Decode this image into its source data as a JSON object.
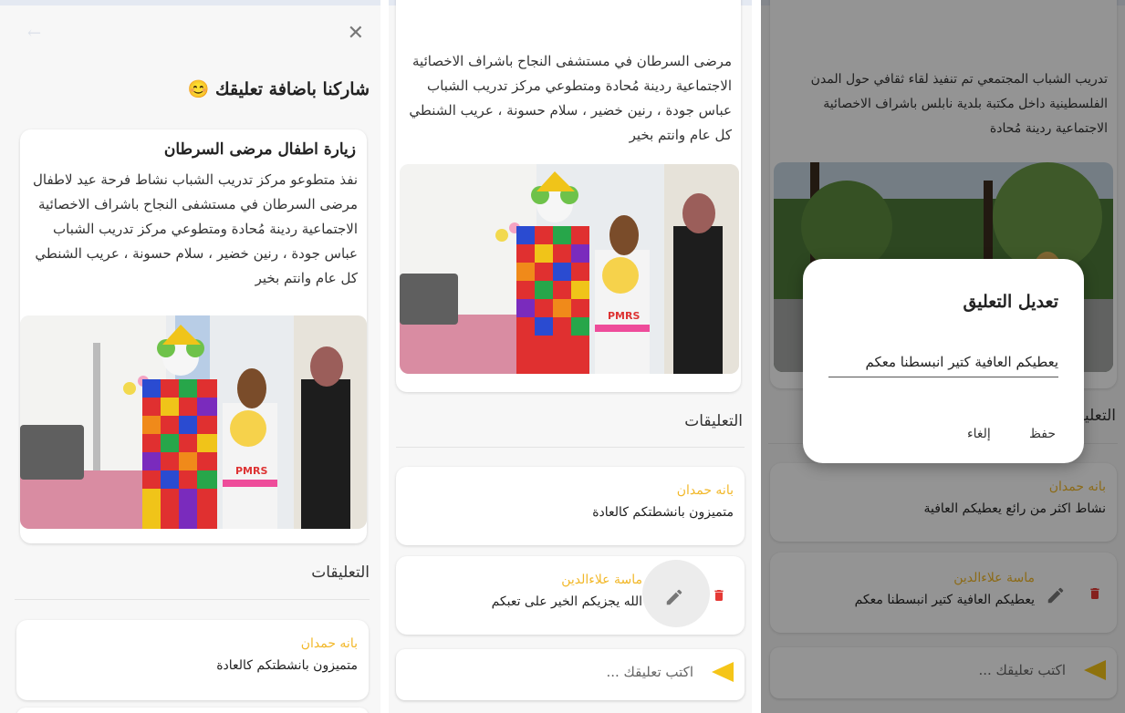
{
  "panel1": {
    "header": "شاركنا باضافة تعليقك 😊",
    "post": {
      "title": "زيارة اطفال مرضى السرطان",
      "body": "نفذ متطوعو مركز تدريب الشباب نشاط فرحة عيد لاطفال مرضى السرطان في مستشفى النجاح باشراف الاخصائية الاجتماعية ردينة مُحادة ومتطوعي مركز تدريب الشباب عباس جودة ، رنين خضير ، سلام حسونة ، عريب الشنطي كل عام وانتم بخير"
    },
    "comments_header": "التعليقات",
    "comments": [
      {
        "name": "بانه حمدان",
        "text": "متميزون بانشطتكم كالعادة"
      }
    ]
  },
  "panel2": {
    "post_body_tail": "مرضى السرطان في مستشفى النجاح باشراف الاخصائية الاجتماعية ردينة مُحادة ومتطوعي مركز تدريب الشباب عباس جودة ، رنين خضير ، سلام حسونة ، عريب الشنطي كل عام وانتم بخير",
    "comments_header": "التعليقات",
    "comments": [
      {
        "name": "بانه حمدان",
        "text": "متميزون بانشطتكم كالعادة"
      },
      {
        "name": "ماسة علاءالدين",
        "text": "الله يجزيكم الخير على تعبكم"
      }
    ],
    "input_placeholder": "اكتب تعليقك ..."
  },
  "panel3": {
    "post_body_tail": "تدريب الشباب المجتمعي تم تنفيذ لقاء ثقافي حول المدن الفلسطينية داخل مكتبة بلدية نابلس باشراف الاخصائية الاجتماعية ردينة مُحادة",
    "comments_header": "التعليقات",
    "comments": [
      {
        "name": "بانه حمدان",
        "text": "نشاط اكثر من رائع يعطيكم العافية"
      },
      {
        "name": "ماسة علاءالدين",
        "text": "يعطيكم العافية كتير انبسطنا معكم"
      }
    ],
    "input_placeholder": "اكتب تعليقك ...",
    "dialog": {
      "title": "تعديل التعليق",
      "value": "يعطيكم العافية كتير انبسطنا معكم",
      "save_label": "حفظ",
      "cancel_label": "إلغاء"
    }
  },
  "colors": {
    "accent": "#f5c518",
    "name": "#f2b82a",
    "delete": "#e53935",
    "icon": "#777777"
  },
  "icons": {
    "close": "close-icon",
    "back": "back-arrow-icon",
    "send": "send-icon",
    "edit": "pencil-icon",
    "delete": "trash-icon"
  }
}
